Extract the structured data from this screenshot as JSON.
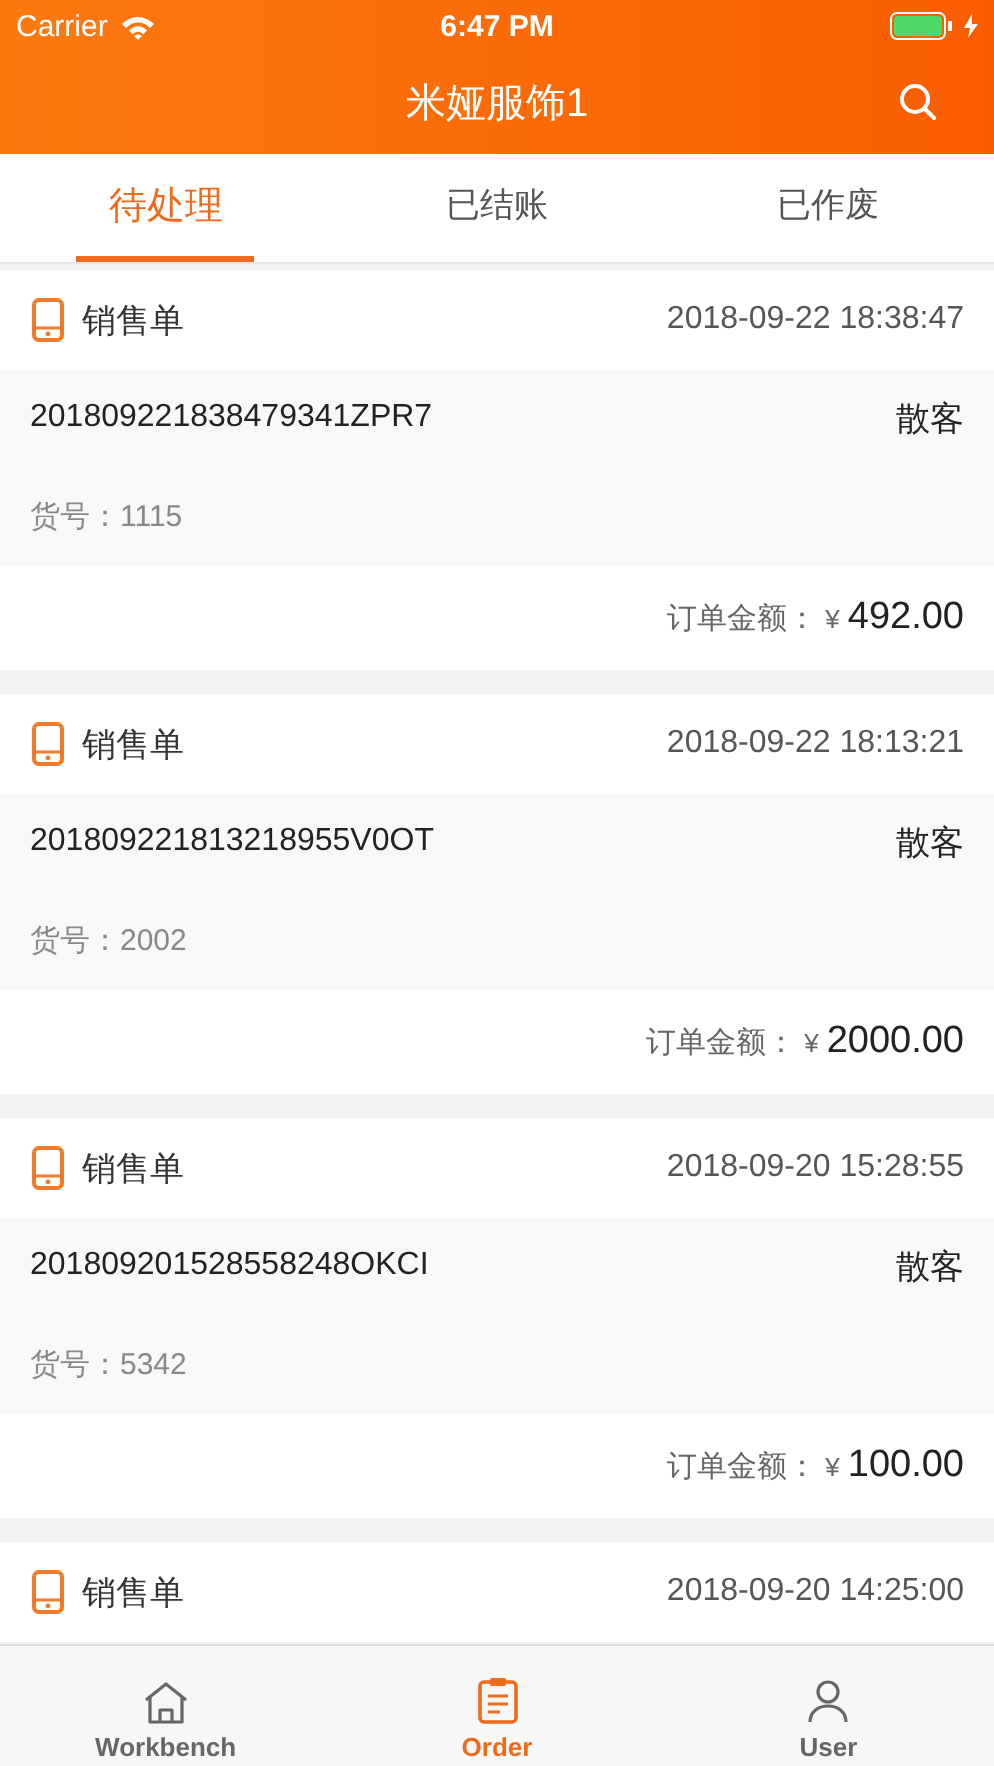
{
  "status_bar": {
    "carrier": "Carrier",
    "time": "6:47 PM"
  },
  "nav": {
    "title": "米娅服饰1"
  },
  "tabs": [
    {
      "label": "待处理",
      "selected": true
    },
    {
      "label": "已结账",
      "selected": false
    },
    {
      "label": "已作废",
      "selected": false
    }
  ],
  "orders": [
    {
      "type": "销售单",
      "datetime": "2018-09-22 18:38:47",
      "number": "201809221838479341ZPR7",
      "customer": "散客",
      "item_no": "货号：1115",
      "amount_label": "订单金额：",
      "currency": "¥",
      "amount": "492.00"
    },
    {
      "type": "销售单",
      "datetime": "2018-09-22 18:13:21",
      "number": "201809221813218955V0OT",
      "customer": "散客",
      "item_no": "货号：2002",
      "amount_label": "订单金额：",
      "currency": "¥",
      "amount": "2000.00"
    },
    {
      "type": "销售单",
      "datetime": "2018-09-20 15:28:55",
      "number": "201809201528558248OKCI",
      "customer": "散客",
      "item_no": "货号：5342",
      "amount_label": "订单金额：",
      "currency": "¥",
      "amount": "100.00"
    },
    {
      "type": "销售单",
      "datetime": "2018-09-20 14:25:00"
    }
  ],
  "tab_bar": [
    {
      "label": "Workbench",
      "kind": "home",
      "selected": false
    },
    {
      "label": "Order",
      "kind": "order",
      "selected": true
    },
    {
      "label": "User",
      "kind": "user",
      "selected": false
    }
  ]
}
